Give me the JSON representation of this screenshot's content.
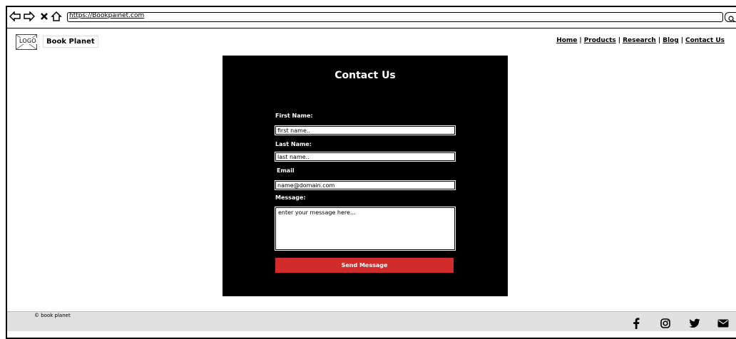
{
  "browser": {
    "url": "https://Bookpainet.com",
    "icons": [
      "back-arrow-icon",
      "forward-arrow-icon",
      "close-icon",
      "home-icon",
      "search-icon"
    ]
  },
  "header": {
    "logo_text": "LOGO",
    "brand": "Book Planet",
    "nav": [
      {
        "label": "Home"
      },
      {
        "label": "Products"
      },
      {
        "label": "Research"
      },
      {
        "label": "Blog"
      },
      {
        "label": "Contact Us"
      }
    ],
    "nav_separator": "|"
  },
  "form": {
    "title": "Contact Us",
    "first_name_label": "First Name:",
    "first_name_placeholder": "first name..",
    "last_name_label": "Last Name:",
    "last_name_placeholder": "last name..",
    "email_label": "Email",
    "email_placeholder": "name@domain.com",
    "message_label": "Message:",
    "message_placeholder": "enter your message here...",
    "send_label": "Send Message"
  },
  "footer": {
    "copyright_symbol": "©",
    "copyright_text": "book planet",
    "social": [
      "facebook-icon",
      "instagram-icon",
      "twitter-icon",
      "email-icon"
    ]
  },
  "colors": {
    "panel_bg": "#000000",
    "accent_button": "#d22b2b",
    "footer_bg": "#e0e0e0"
  }
}
